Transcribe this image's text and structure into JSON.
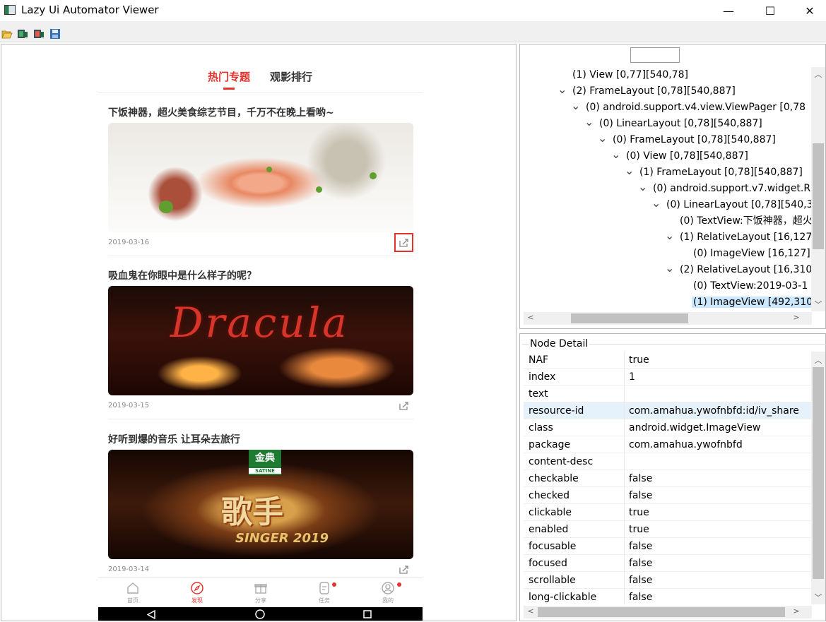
{
  "window": {
    "title": "Lazy Ui Automator Viewer",
    "minimize_glyph": "—",
    "maximize_glyph": "☐",
    "close_glyph": "✕"
  },
  "toolbar": {
    "icons": [
      "open-folder-icon",
      "device-screenshot-icon",
      "device-screenshot-compressed-icon",
      "save-icon"
    ]
  },
  "phone": {
    "tabs": [
      {
        "label": "热门专题",
        "active": true
      },
      {
        "label": "观影排行",
        "active": false
      }
    ],
    "cards": [
      {
        "title": "下饭神器，超火美食综艺节目，千万不在晚上看哟~",
        "date": "2019-03-16",
        "image": "food-photo",
        "share_selected": true
      },
      {
        "title": "吸血鬼在你眼中是什么样子的呢？",
        "date": "2019-03-15",
        "image": "dracula-poster",
        "image_text": "Dracula",
        "share_selected": false
      },
      {
        "title": "好听到爆的音乐 让耳朵去旅行",
        "date": "2019-03-14",
        "image": "singer-poster",
        "image_text": "歌手",
        "badge_top": "金典",
        "badge_bottom": "SATINE",
        "image_sub": "SINGER 2019",
        "share_selected": false
      }
    ],
    "bottom_nav": [
      {
        "label": "首页",
        "icon": "home-icon",
        "active": false,
        "dot": false
      },
      {
        "label": "发现",
        "icon": "compass-icon",
        "active": true,
        "dot": false
      },
      {
        "label": "分享",
        "icon": "gift-icon",
        "active": false,
        "dot": false
      },
      {
        "label": "任务",
        "icon": "task-icon",
        "active": false,
        "dot": true
      },
      {
        "label": "我的",
        "icon": "profile-icon",
        "active": false,
        "dot": true
      }
    ],
    "accent_color": "#e5322d"
  },
  "tree": {
    "rows": [
      {
        "indent": 0,
        "expander": "",
        "text": "(1) View [0,77][540,78]",
        "selected": false
      },
      {
        "indent": 0,
        "expander": "v",
        "text": "(2) FrameLayout [0,78][540,887]",
        "selected": false
      },
      {
        "indent": 1,
        "expander": "v",
        "text": "(0) android.support.v4.view.ViewPager [0,78",
        "selected": false
      },
      {
        "indent": 2,
        "expander": "v",
        "text": "(0) LinearLayout [0,78][540,887]",
        "selected": false
      },
      {
        "indent": 3,
        "expander": "v",
        "text": "(0) FrameLayout [0,78][540,887]",
        "selected": false
      },
      {
        "indent": 4,
        "expander": "v",
        "text": "(0) View [0,78][540,887]",
        "selected": false
      },
      {
        "indent": 5,
        "expander": "v",
        "text": "(1) FrameLayout [0,78][540,887]",
        "selected": false
      },
      {
        "indent": 6,
        "expander": "v",
        "text": "(0) android.support.v7.widget.R",
        "selected": false
      },
      {
        "indent": 7,
        "expander": "v",
        "text": "(0) LinearLayout [0,78][540,3",
        "selected": false
      },
      {
        "indent": 8,
        "expander": "",
        "text": "(0) TextView:下饭神器，超火",
        "selected": false
      },
      {
        "indent": 8,
        "expander": "v",
        "text": "(1) RelativeLayout [16,127",
        "selected": false
      },
      {
        "indent": 9,
        "expander": "",
        "text": "(0) ImageView [16,127][",
        "selected": false
      },
      {
        "indent": 8,
        "expander": "v",
        "text": "(2) RelativeLayout [16,310",
        "selected": false
      },
      {
        "indent": 9,
        "expander": "",
        "text": "(0) TextView:2019-03-1",
        "selected": false
      },
      {
        "indent": 9,
        "expander": "",
        "text": "(1) ImageView [492,310",
        "selected": true
      }
    ]
  },
  "node_detail": {
    "title": "Node Detail",
    "properties": [
      {
        "key": "NAF",
        "value": "true",
        "highlight": false
      },
      {
        "key": "index",
        "value": "1",
        "highlight": false
      },
      {
        "key": "text",
        "value": "",
        "highlight": false
      },
      {
        "key": "resource-id",
        "value": "com.amahua.ywofnbfd:id/iv_share",
        "highlight": true
      },
      {
        "key": "class",
        "value": "android.widget.ImageView",
        "highlight": false
      },
      {
        "key": "package",
        "value": "com.amahua.ywofnbfd",
        "highlight": false
      },
      {
        "key": "content-desc",
        "value": "",
        "highlight": false
      },
      {
        "key": "checkable",
        "value": "false",
        "highlight": false
      },
      {
        "key": "checked",
        "value": "false",
        "highlight": false
      },
      {
        "key": "clickable",
        "value": "true",
        "highlight": false
      },
      {
        "key": "enabled",
        "value": "true",
        "highlight": false
      },
      {
        "key": "focusable",
        "value": "false",
        "highlight": false
      },
      {
        "key": "focused",
        "value": "false",
        "highlight": false
      },
      {
        "key": "scrollable",
        "value": "false",
        "highlight": false
      },
      {
        "key": "long-clickable",
        "value": "false",
        "highlight": false
      }
    ]
  }
}
